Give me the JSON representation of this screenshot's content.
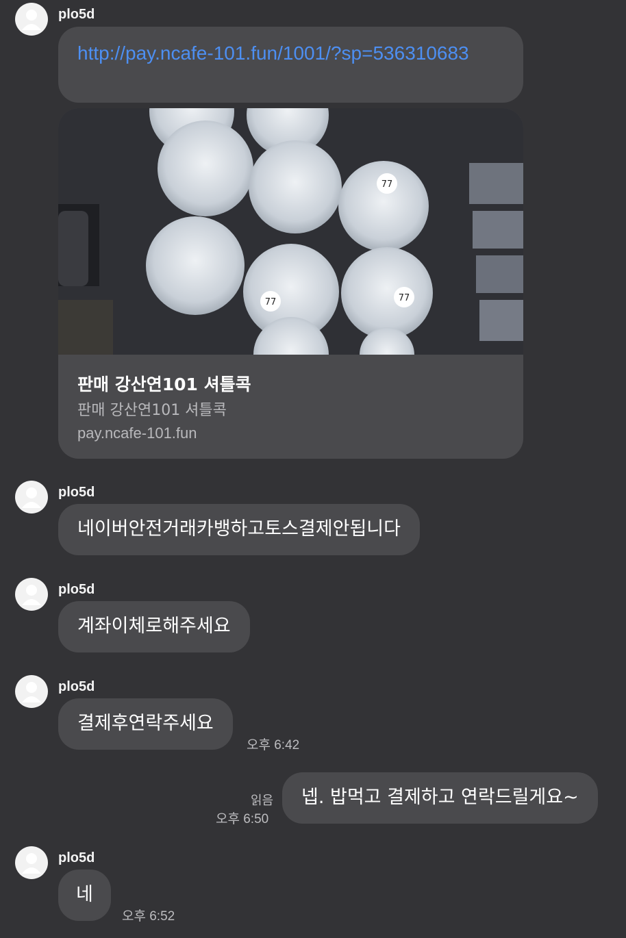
{
  "sender_name": "plo5d",
  "messages": {
    "link_text": "http://pay.ncafe-101.fun/1001/?sp=536310683",
    "preview": {
      "title": "판매 강산연101 셔틀콕",
      "subtitle": "판매 강산연101 셔틀콕",
      "domain": "pay.ncafe-101.fun",
      "image_labels": [
        "77",
        "77",
        "77"
      ]
    },
    "m1": "네이버안전거래카뱅하고토스결제안됩니다",
    "m2": "계좌이체로해주세요",
    "m3": "결제후연락주세요",
    "m3_time": "오후 6:42",
    "mine": "넵. 밥먹고 결제하고 연락드릴게요~",
    "mine_read": "읽음",
    "mine_time": "오후 6:50",
    "m4": "네",
    "m4_time": "오후 6:52"
  },
  "colors": {
    "background": "#333336",
    "bubble": "#4a4a4d",
    "link": "#4d8ff2"
  }
}
